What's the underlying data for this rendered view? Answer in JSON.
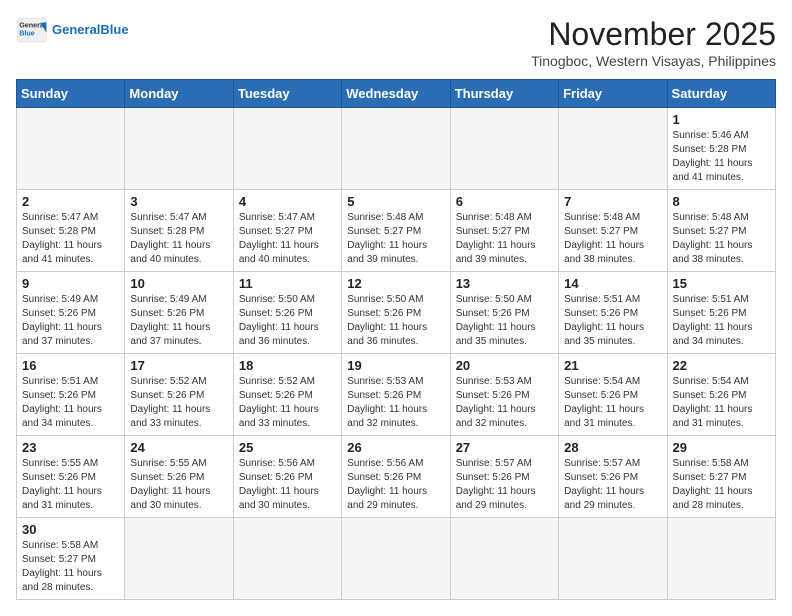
{
  "header": {
    "logo_general": "General",
    "logo_blue": "Blue",
    "month_title": "November 2025",
    "location": "Tinogboc, Western Visayas, Philippines"
  },
  "days_of_week": [
    "Sunday",
    "Monday",
    "Tuesday",
    "Wednesday",
    "Thursday",
    "Friday",
    "Saturday"
  ],
  "weeks": [
    [
      {
        "day": "",
        "empty": true
      },
      {
        "day": "",
        "empty": true
      },
      {
        "day": "",
        "empty": true
      },
      {
        "day": "",
        "empty": true
      },
      {
        "day": "",
        "empty": true
      },
      {
        "day": "",
        "empty": true
      },
      {
        "day": "1",
        "sunrise": "Sunrise: 5:46 AM",
        "sunset": "Sunset: 5:28 PM",
        "daylight": "Daylight: 11 hours and 41 minutes."
      }
    ],
    [
      {
        "day": "2",
        "sunrise": "Sunrise: 5:47 AM",
        "sunset": "Sunset: 5:28 PM",
        "daylight": "Daylight: 11 hours and 41 minutes."
      },
      {
        "day": "3",
        "sunrise": "Sunrise: 5:47 AM",
        "sunset": "Sunset: 5:28 PM",
        "daylight": "Daylight: 11 hours and 40 minutes."
      },
      {
        "day": "4",
        "sunrise": "Sunrise: 5:47 AM",
        "sunset": "Sunset: 5:27 PM",
        "daylight": "Daylight: 11 hours and 40 minutes."
      },
      {
        "day": "5",
        "sunrise": "Sunrise: 5:48 AM",
        "sunset": "Sunset: 5:27 PM",
        "daylight": "Daylight: 11 hours and 39 minutes."
      },
      {
        "day": "6",
        "sunrise": "Sunrise: 5:48 AM",
        "sunset": "Sunset: 5:27 PM",
        "daylight": "Daylight: 11 hours and 39 minutes."
      },
      {
        "day": "7",
        "sunrise": "Sunrise: 5:48 AM",
        "sunset": "Sunset: 5:27 PM",
        "daylight": "Daylight: 11 hours and 38 minutes."
      },
      {
        "day": "8",
        "sunrise": "Sunrise: 5:48 AM",
        "sunset": "Sunset: 5:27 PM",
        "daylight": "Daylight: 11 hours and 38 minutes."
      }
    ],
    [
      {
        "day": "9",
        "sunrise": "Sunrise: 5:49 AM",
        "sunset": "Sunset: 5:26 PM",
        "daylight": "Daylight: 11 hours and 37 minutes."
      },
      {
        "day": "10",
        "sunrise": "Sunrise: 5:49 AM",
        "sunset": "Sunset: 5:26 PM",
        "daylight": "Daylight: 11 hours and 37 minutes."
      },
      {
        "day": "11",
        "sunrise": "Sunrise: 5:50 AM",
        "sunset": "Sunset: 5:26 PM",
        "daylight": "Daylight: 11 hours and 36 minutes."
      },
      {
        "day": "12",
        "sunrise": "Sunrise: 5:50 AM",
        "sunset": "Sunset: 5:26 PM",
        "daylight": "Daylight: 11 hours and 36 minutes."
      },
      {
        "day": "13",
        "sunrise": "Sunrise: 5:50 AM",
        "sunset": "Sunset: 5:26 PM",
        "daylight": "Daylight: 11 hours and 35 minutes."
      },
      {
        "day": "14",
        "sunrise": "Sunrise: 5:51 AM",
        "sunset": "Sunset: 5:26 PM",
        "daylight": "Daylight: 11 hours and 35 minutes."
      },
      {
        "day": "15",
        "sunrise": "Sunrise: 5:51 AM",
        "sunset": "Sunset: 5:26 PM",
        "daylight": "Daylight: 11 hours and 34 minutes."
      }
    ],
    [
      {
        "day": "16",
        "sunrise": "Sunrise: 5:51 AM",
        "sunset": "Sunset: 5:26 PM",
        "daylight": "Daylight: 11 hours and 34 minutes."
      },
      {
        "day": "17",
        "sunrise": "Sunrise: 5:52 AM",
        "sunset": "Sunset: 5:26 PM",
        "daylight": "Daylight: 11 hours and 33 minutes."
      },
      {
        "day": "18",
        "sunrise": "Sunrise: 5:52 AM",
        "sunset": "Sunset: 5:26 PM",
        "daylight": "Daylight: 11 hours and 33 minutes."
      },
      {
        "day": "19",
        "sunrise": "Sunrise: 5:53 AM",
        "sunset": "Sunset: 5:26 PM",
        "daylight": "Daylight: 11 hours and 32 minutes."
      },
      {
        "day": "20",
        "sunrise": "Sunrise: 5:53 AM",
        "sunset": "Sunset: 5:26 PM",
        "daylight": "Daylight: 11 hours and 32 minutes."
      },
      {
        "day": "21",
        "sunrise": "Sunrise: 5:54 AM",
        "sunset": "Sunset: 5:26 PM",
        "daylight": "Daylight: 11 hours and 31 minutes."
      },
      {
        "day": "22",
        "sunrise": "Sunrise: 5:54 AM",
        "sunset": "Sunset: 5:26 PM",
        "daylight": "Daylight: 11 hours and 31 minutes."
      }
    ],
    [
      {
        "day": "23",
        "sunrise": "Sunrise: 5:55 AM",
        "sunset": "Sunset: 5:26 PM",
        "daylight": "Daylight: 11 hours and 31 minutes."
      },
      {
        "day": "24",
        "sunrise": "Sunrise: 5:55 AM",
        "sunset": "Sunset: 5:26 PM",
        "daylight": "Daylight: 11 hours and 30 minutes."
      },
      {
        "day": "25",
        "sunrise": "Sunrise: 5:56 AM",
        "sunset": "Sunset: 5:26 PM",
        "daylight": "Daylight: 11 hours and 30 minutes."
      },
      {
        "day": "26",
        "sunrise": "Sunrise: 5:56 AM",
        "sunset": "Sunset: 5:26 PM",
        "daylight": "Daylight: 11 hours and 29 minutes."
      },
      {
        "day": "27",
        "sunrise": "Sunrise: 5:57 AM",
        "sunset": "Sunset: 5:26 PM",
        "daylight": "Daylight: 11 hours and 29 minutes."
      },
      {
        "day": "28",
        "sunrise": "Sunrise: 5:57 AM",
        "sunset": "Sunset: 5:26 PM",
        "daylight": "Daylight: 11 hours and 29 minutes."
      },
      {
        "day": "29",
        "sunrise": "Sunrise: 5:58 AM",
        "sunset": "Sunset: 5:27 PM",
        "daylight": "Daylight: 11 hours and 28 minutes."
      }
    ],
    [
      {
        "day": "30",
        "sunrise": "Sunrise: 5:58 AM",
        "sunset": "Sunset: 5:27 PM",
        "daylight": "Daylight: 11 hours and 28 minutes."
      },
      {
        "day": "",
        "empty": true
      },
      {
        "day": "",
        "empty": true
      },
      {
        "day": "",
        "empty": true
      },
      {
        "day": "",
        "empty": true
      },
      {
        "day": "",
        "empty": true
      },
      {
        "day": "",
        "empty": true
      }
    ]
  ]
}
